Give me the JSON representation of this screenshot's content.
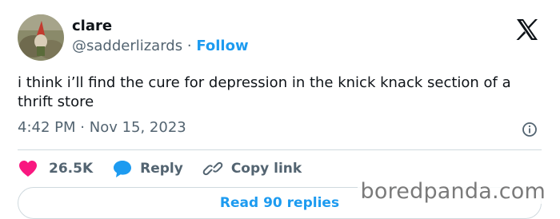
{
  "author": {
    "name": "clare",
    "handle": "@sadderlizards",
    "separator": "·",
    "follow_label": "Follow"
  },
  "tweet": {
    "text": "i think i’ll find the cure for depression in the knick knack section of a thrift store",
    "time": "4:42 PM",
    "date_separator": "·",
    "date": "Nov 15, 2023"
  },
  "actions": {
    "likes_count": "26.5K",
    "reply_label": "Reply",
    "copy_label": "Copy link"
  },
  "bottom": {
    "button_label": "Read 90 replies"
  },
  "watermark": {
    "text": "boredpanda.com"
  },
  "icons": {
    "avatar": "avatar-image",
    "x_logo": "x-logo-icon",
    "info": "info-icon",
    "heart": "heart-icon",
    "reply": "reply-bubble-icon",
    "link": "link-icon"
  },
  "colors": {
    "accent": "#1d9bf0",
    "heart": "#f91880",
    "text_primary": "#0f1419",
    "text_secondary": "#536471"
  }
}
